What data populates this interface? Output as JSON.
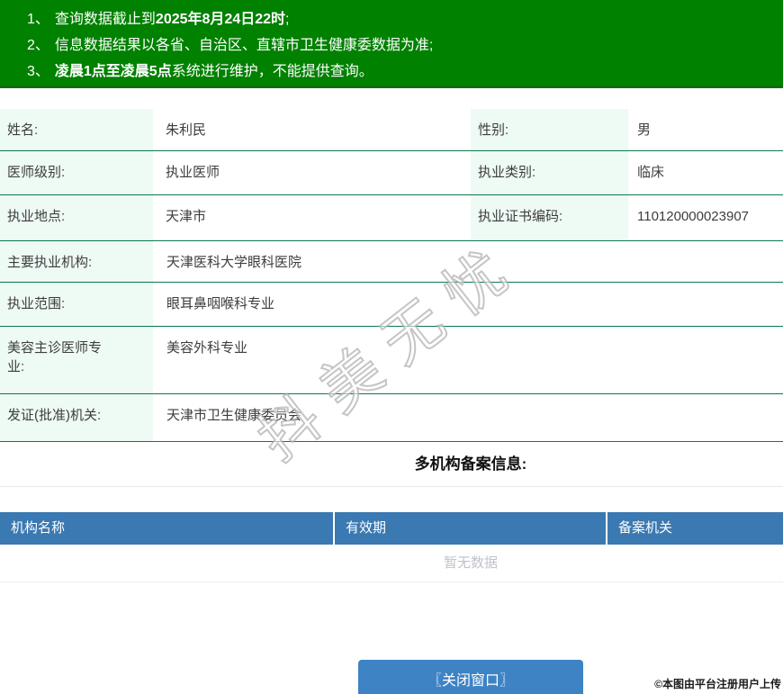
{
  "notice": [
    {
      "num": "1、",
      "pre": "查询数据截止到",
      "bold": "2025年8月24日22时",
      "post": ";"
    },
    {
      "num": "2、",
      "pre": "信息数据结果以各省、自治区、直辖市卫生健康委数据为准;",
      "bold": "",
      "post": ""
    },
    {
      "num": "3、",
      "pre": "",
      "bold": "凌晨1点至凌晨5点",
      "post": "系统进行维护，不能提供查询。"
    }
  ],
  "info_rows": [
    {
      "label": "姓名:",
      "value": "朱利民",
      "label2": "性别:",
      "value2": "男"
    },
    {
      "label": "医师级别:",
      "value": "执业医师",
      "label2": "执业类别:",
      "value2": "临床"
    },
    {
      "label": "执业地点:",
      "value": "天津市",
      "label2": "执业证书编码:",
      "value2": "110120000023907"
    },
    {
      "label": "主要执业机构:",
      "value": "天津医科大学眼科医院"
    },
    {
      "label": "执业范围:",
      "value": "眼耳鼻咽喉科专业"
    },
    {
      "label": "美容主诊医师专业:",
      "value": "美容外科专业"
    },
    {
      "label": "发证(批准)机关:",
      "value": "天津市卫生健康委员会"
    }
  ],
  "section": {
    "title": "多机构备案信息:"
  },
  "org_table": {
    "headers": [
      "机构名称",
      "有效期",
      "备案机关"
    ],
    "empty_text": "暂无数据"
  },
  "footer": {
    "close_button": "〖关闭窗口〗",
    "copyright": "©本图由平台注册用户上传"
  },
  "watermark": {
    "text": "抖美无忧"
  },
  "colors": {
    "banner_green": "#008100",
    "table_border_green": "#0b7a4c",
    "label_bg": "#eefaf4",
    "header_blue": "#3a79b1",
    "button_blue": "#3e83c4",
    "empty_text_gray": "#bfc3c9"
  }
}
